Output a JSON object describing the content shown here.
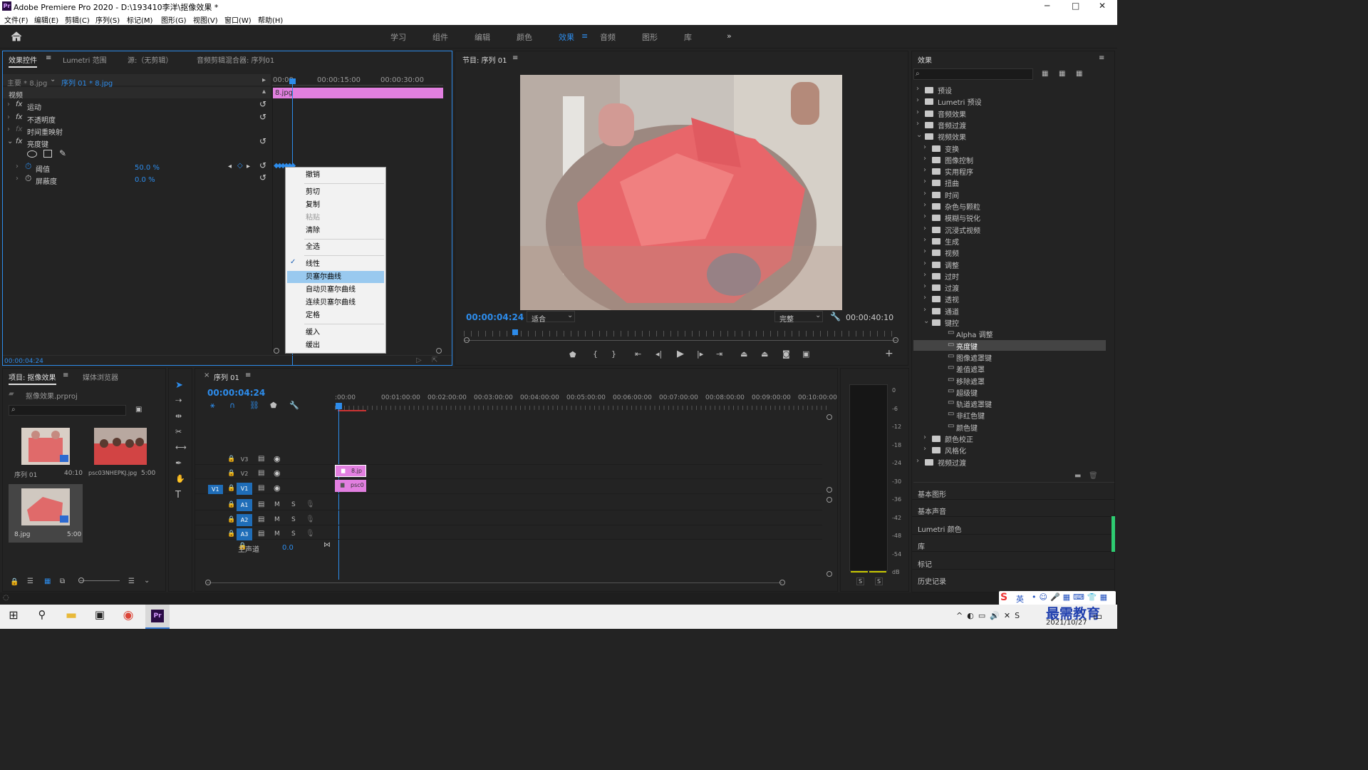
{
  "titlebar": {
    "logo": "Pr",
    "title": "Adobe Premiere Pro 2020 - D:\\193410李洋\\抠像效果 *",
    "min": "─",
    "max": "□",
    "close": "✕"
  },
  "menu": [
    "文件(F)",
    "编辑(E)",
    "剪辑(C)",
    "序列(S)",
    "标记(M)",
    "图形(G)",
    "视图(V)",
    "窗口(W)",
    "帮助(H)"
  ],
  "workspaces": [
    "学习",
    "组件",
    "编辑",
    "颜色",
    "效果",
    "音频",
    "图形",
    "库"
  ],
  "workspace_active": "效果",
  "effect_controls": {
    "tabs": [
      "效果控件",
      "Lumetri 范围",
      "源:（无剪辑）",
      "音频剪辑混合器: 序列01"
    ],
    "master": "主要 * 8.jpg",
    "seq": "序列 01 * 8.jpg",
    "ruler": [
      "00:00",
      "00:00:15:00",
      "00:00:30:00"
    ],
    "clip": "8.jpg",
    "video_label": "视频",
    "fx": [
      "运动",
      "不透明度",
      "时间重映射",
      "亮度键"
    ],
    "threshold_label": "阈值",
    "threshold_value": "50.0 %",
    "cutoff_label": "屏蔽度",
    "cutoff_value": "0.0 %",
    "time": "00:00:04:24"
  },
  "context_menu": [
    "撤销",
    "剪切",
    "复制",
    "粘贴",
    "清除",
    "全选",
    "线性",
    "贝塞尔曲线",
    "自动贝塞尔曲线",
    "连续贝塞尔曲线",
    "定格",
    "缓入",
    "缓出"
  ],
  "program": {
    "title": "节目: 序列 01",
    "time": "00:00:04:24",
    "fit": "适合",
    "quality": "完整",
    "duration": "00:00:40:10"
  },
  "effects": {
    "title": "效果",
    "top": [
      "预设",
      "Lumetri 预设",
      "音频效果",
      "音频过渡",
      "视频效果"
    ],
    "video": [
      "变换",
      "图像控制",
      "实用程序",
      "扭曲",
      "时间",
      "杂色与颗粒",
      "模糊与锐化",
      "沉浸式视频",
      "生成",
      "视频",
      "调整",
      "过时",
      "过渡",
      "透视",
      "通道",
      "键控"
    ],
    "keying": [
      "Alpha 调整",
      "亮度键",
      "图像遮罩键",
      "差值遮罩",
      "移除遮罩",
      "超级键",
      "轨道遮罩键",
      "非红色键",
      "颜色键"
    ],
    "bottom": [
      "颜色校正",
      "风格化"
    ],
    "last": "视频过渡",
    "panels": [
      "基本图形",
      "基本声音",
      "Lumetri 颜色",
      "库",
      "标记",
      "历史记录"
    ]
  },
  "project": {
    "tabs": [
      "项目: 抠像效果",
      "媒体浏览器"
    ],
    "file": "抠像效果.prproj",
    "items": [
      {
        "name": "序列 01",
        "dur": "40:10"
      },
      {
        "name": "psc03NHEPKJ.jpg",
        "dur": "5:00"
      },
      {
        "name": "8.jpg",
        "dur": "5:00"
      }
    ]
  },
  "timeline": {
    "tab": "序列 01",
    "time": "00:00:04:24",
    "ruler": [
      ":00:00",
      "00:01:00:00",
      "00:02:00:00",
      "00:03:00:00",
      "00:04:00:00",
      "00:05:00:00",
      "00:06:00:00",
      "00:07:00:00",
      "00:08:00:00",
      "00:09:00:00",
      "00:10:00:00"
    ],
    "tracks": [
      "V3",
      "V2",
      "V1",
      "A1",
      "A2",
      "A3"
    ],
    "master": "主声道",
    "master_val": "0.0",
    "clip_v2": "8.jp",
    "clip_v1": "psc0",
    "src_v1": "V1"
  },
  "meter": {
    "labels": [
      "0",
      "-6",
      "-12",
      "-18",
      "-24",
      "-30",
      "-36",
      "-42",
      "-48",
      "-54",
      "dB"
    ],
    "s": [
      "S",
      "S"
    ]
  },
  "taskbar": {
    "date": "2021/10/27",
    "brand": "最需教育",
    "ime": "英"
  }
}
